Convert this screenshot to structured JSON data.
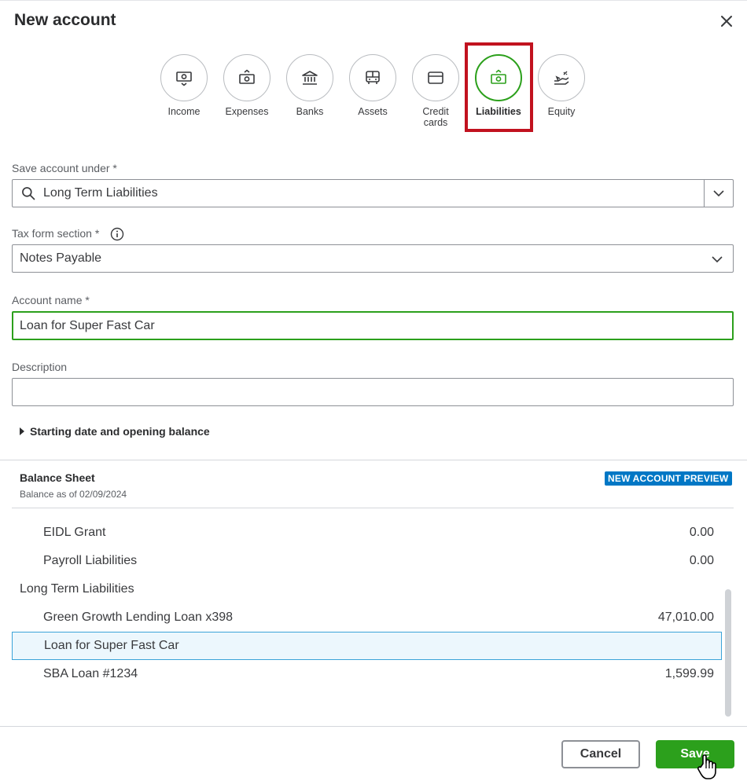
{
  "dialog": {
    "title": "New account"
  },
  "account_types": [
    {
      "label": "Income",
      "icon": "income-icon"
    },
    {
      "label": "Expenses",
      "icon": "expenses-icon"
    },
    {
      "label": "Banks",
      "icon": "bank-icon"
    },
    {
      "label": "Assets",
      "icon": "assets-icon"
    },
    {
      "label": "Credit cards",
      "icon": "credit-card-icon"
    },
    {
      "label": "Liabilities",
      "icon": "liabilities-icon",
      "selected": true
    },
    {
      "label": "Equity",
      "icon": "equity-icon"
    }
  ],
  "form": {
    "save_under_label": "Save account under *",
    "save_under_value": "Long Term Liabilities",
    "tax_section_label": "Tax form section *",
    "tax_section_value": "Notes Payable",
    "account_name_label": "Account name *",
    "account_name_value": "Loan for Super Fast Car",
    "description_label": "Description",
    "description_value": "",
    "opening_balance_toggle": "Starting date and opening balance"
  },
  "balance_sheet": {
    "title": "Balance Sheet",
    "subtitle": "Balance as of 02/09/2024",
    "badge": "NEW ACCOUNT PREVIEW",
    "rows": [
      {
        "name": "EIDL Grant",
        "amount": "0.00",
        "indent": 1
      },
      {
        "name": "Payroll Liabilities",
        "amount": "0.00",
        "indent": 1
      },
      {
        "name": "Long Term Liabilities",
        "amount": "",
        "indent": 0
      },
      {
        "name": "Green Growth Lending Loan x398",
        "amount": "47,010.00",
        "indent": 1
      },
      {
        "name": "Loan for Super Fast Car",
        "amount": "",
        "indent": 1,
        "highlighted": true
      },
      {
        "name": "SBA Loan #1234",
        "amount": "1,599.99",
        "indent": 1
      }
    ]
  },
  "footer": {
    "cancel_label": "Cancel",
    "save_label": "Save"
  },
  "colors": {
    "accent": "#2ca01c",
    "highlight_box": "#c1121f",
    "badge": "#0077c5",
    "selected_row": "#ecf7fd"
  }
}
